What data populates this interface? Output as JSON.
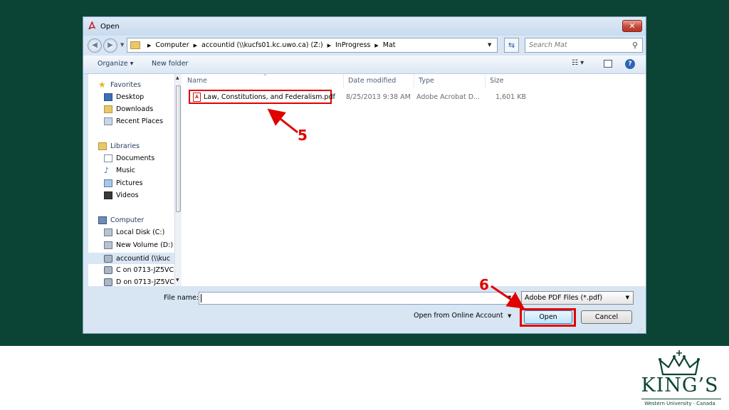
{
  "dialog": {
    "title": "Open",
    "close_glyph": "✕",
    "address": {
      "crumbs": [
        "Computer",
        "accountid (\\\\kucfs01.kc.uwo.ca) (Z:)",
        "InProgress",
        "Mat"
      ],
      "separator": "▶"
    },
    "search": {
      "placeholder": "Search Mat"
    },
    "toolbar": {
      "organize": "Organize ▾",
      "new_folder": "New folder"
    },
    "nav": {
      "favorites": {
        "header": "Favorites",
        "items": [
          "Desktop",
          "Downloads",
          "Recent Places"
        ]
      },
      "libraries": {
        "header": "Libraries",
        "items": [
          "Documents",
          "Music",
          "Pictures",
          "Videos"
        ]
      },
      "computer": {
        "header": "Computer",
        "items": [
          "Local Disk (C:)",
          "New Volume (D:)",
          "accountid (\\\\kuc",
          "C on 0713-JZ5VC",
          "D on 0713-JZ5VC"
        ]
      }
    },
    "columns": {
      "name": "Name",
      "date": "Date modified",
      "type": "Type",
      "size": "Size"
    },
    "file": {
      "name": "Law, Constitutions, and Federalism.pdf",
      "date": "8/25/2013 9:38 AM",
      "type": "Adobe Acrobat D...",
      "size": "1,601 KB"
    },
    "bottom": {
      "file_name_label": "File name:",
      "file_name_value": "",
      "filter": "Adobe PDF Files (*.pdf)",
      "online": "Open from Online Account",
      "open": "Open",
      "cancel": "Cancel"
    }
  },
  "callouts": {
    "step5": "5",
    "step6": "6"
  },
  "logo": {
    "name": "KING’S",
    "tagline": "Western University · Canada"
  },
  "colors": {
    "slide_bg": "#0b4434",
    "highlight": "#e00000"
  }
}
